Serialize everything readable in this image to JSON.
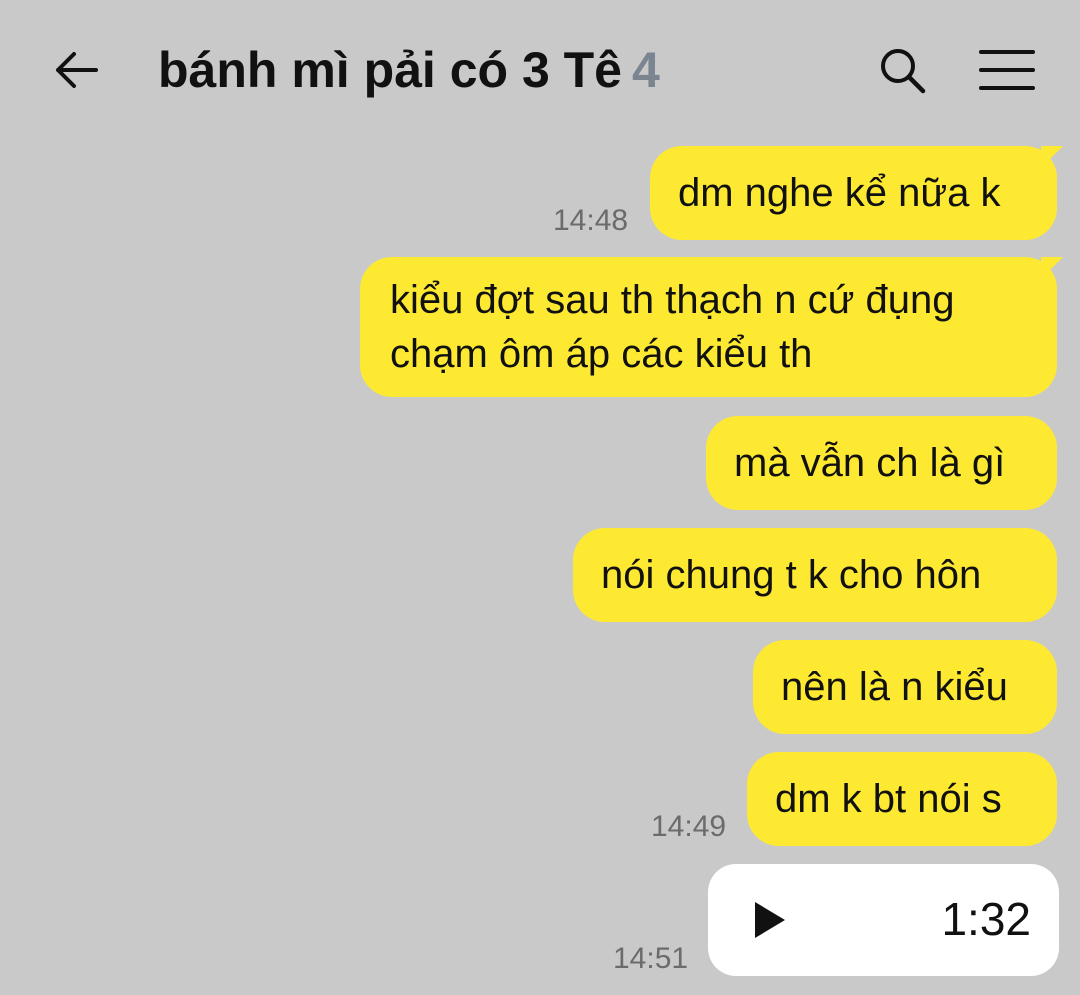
{
  "header": {
    "back_icon": "arrow-left-icon",
    "title": "bánh mì pải có 3 Tê",
    "member_count": "4",
    "search_icon": "search-icon",
    "menu_icon": "hamburger-menu-icon"
  },
  "messages": [
    {
      "text": "dm nghe kể nữa k",
      "time": "14:48"
    },
    {
      "text": "kiểu đợt sau th thạch n cứ đụng chạm ôm áp các kiểu th"
    },
    {
      "text": "mà vẫn ch là gì"
    },
    {
      "text": "nói chung t k cho hôn"
    },
    {
      "text": "nên là n kiểu"
    },
    {
      "text": "dm k bt nói s",
      "time": "14:49"
    }
  ],
  "voice_message": {
    "play_icon": "play-icon",
    "duration": "1:32",
    "time": "14:51"
  },
  "colors": {
    "background": "#c9c9c9",
    "bubble": "#fee932",
    "voice_bubble": "#ffffff",
    "member_count": "#7b8590"
  }
}
